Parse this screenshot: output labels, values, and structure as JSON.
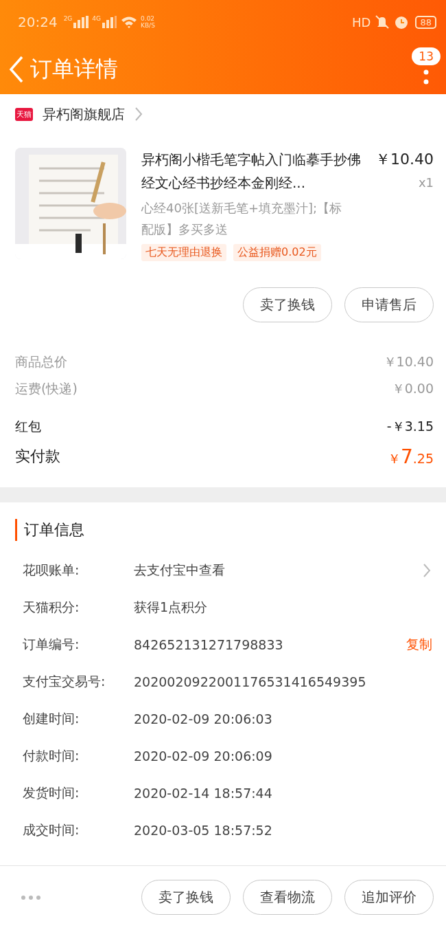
{
  "status_bar": {
    "time": "20:24",
    "net1": "2G",
    "net2": "4G",
    "speed": "0.02",
    "speed_unit": "KB/S",
    "hd": "HD",
    "battery": "88"
  },
  "header": {
    "title": "订单详情",
    "badge": "13"
  },
  "store": {
    "name": "异朽阁旗舰店",
    "logo": "天猫"
  },
  "product": {
    "title": "异朽阁小楷毛笔字帖入门临摹手抄佛经文心经书抄经本金刚经...",
    "price": "￥10.40",
    "qty": "x1",
    "sku": "心经40张[送新毛笔+填充墨汁];【标配版】多买多送",
    "tags": [
      "七天无理由退换",
      "公益捐赠0.02元"
    ],
    "buttons": [
      "卖了换钱",
      "申请售后"
    ]
  },
  "costs": [
    {
      "label": "商品总价",
      "value": "￥10.40",
      "kind": "minor"
    },
    {
      "label": "运费(快递)",
      "value": "￥0.00",
      "kind": "minor"
    },
    {
      "label": "红包",
      "value": "-￥3.15",
      "kind": "major"
    }
  ],
  "payment": {
    "label": "实付款",
    "currency": "￥",
    "integer": "7",
    "fraction": ".25"
  },
  "order_info": {
    "title": "订单信息",
    "rows": [
      {
        "label": "花呗账单:",
        "value": "去支付宝中查看",
        "arrow": true
      },
      {
        "label": "天猫积分:",
        "value": "获得1点积分",
        "arrow": false
      },
      {
        "label": "订单编号:",
        "value": "842652131271798833",
        "arrow": false,
        "action": "复制"
      },
      {
        "label": "支付宝交易号:",
        "value": "2020020922001176531416549395",
        "arrow": false
      },
      {
        "label": "创建时间:",
        "value": "2020-02-09 20:06:03",
        "arrow": false
      },
      {
        "label": "付款时间:",
        "value": "2020-02-09 20:06:09",
        "arrow": false
      },
      {
        "label": "发货时间:",
        "value": "2020-02-14 18:57:44",
        "arrow": false
      },
      {
        "label": "成交时间:",
        "value": "2020-03-05 18:57:52",
        "arrow": false
      }
    ]
  },
  "bottom_bar": {
    "buttons": [
      "卖了换钱",
      "查看物流",
      "追加评价"
    ]
  }
}
